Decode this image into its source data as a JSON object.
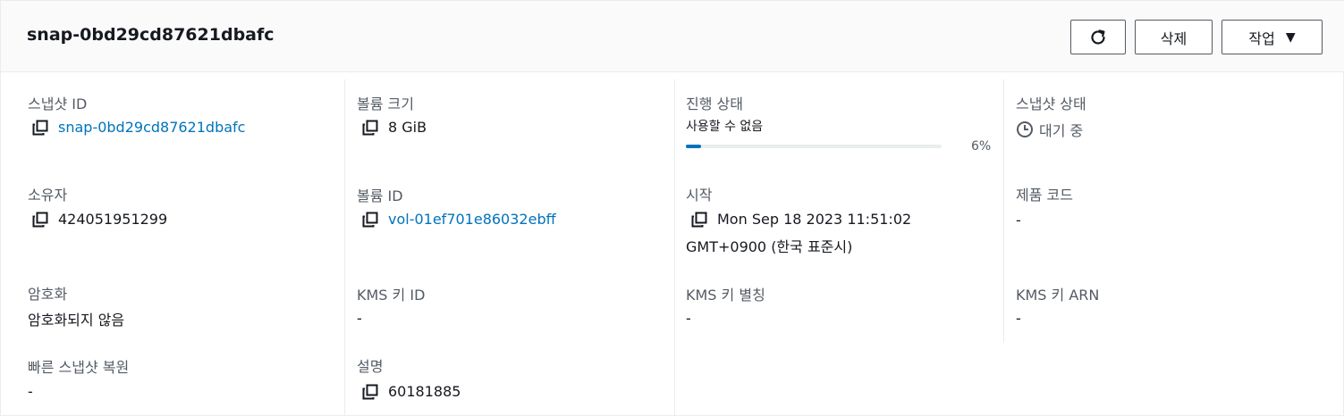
{
  "header": {
    "title": "snap-0bd29cd87621dbafc",
    "refresh_icon": "refresh-icon",
    "delete_label": "삭제",
    "actions_label": "작업",
    "actions_caret": "▼"
  },
  "details": {
    "snapshot_id": {
      "label": "스냅샷 ID",
      "value": "snap-0bd29cd87621dbafc"
    },
    "volume_size": {
      "label": "볼륨 크기",
      "value": "8 GiB"
    },
    "progress": {
      "label": "진행 상태",
      "sub": "사용할 수 없음",
      "percent_text": "6%",
      "percent": 6
    },
    "snapshot_state": {
      "label": "스냅샷 상태",
      "value": "대기 중"
    },
    "owner": {
      "label": "소유자",
      "value": "424051951299"
    },
    "volume_id": {
      "label": "볼륨 ID",
      "value": "vol-01ef701e86032ebff"
    },
    "started": {
      "label": "시작",
      "value_line1": "Mon Sep 18 2023 11:51:02",
      "value_line2": "GMT+0900 (한국 표준시)"
    },
    "product_codes": {
      "label": "제품 코드",
      "value": "-"
    },
    "encryption": {
      "label": "암호화",
      "value": "암호화되지 않음"
    },
    "kms_key_id": {
      "label": "KMS 키 ID",
      "value": "-"
    },
    "kms_key_alias": {
      "label": "KMS 키 별칭",
      "value": "-"
    },
    "kms_key_arn": {
      "label": "KMS 키 ARN",
      "value": "-"
    },
    "fast_snapshot_restore": {
      "label": "빠른 스냅샷 복원",
      "value": "-"
    },
    "description": {
      "label": "설명",
      "value": "60181885"
    }
  },
  "colors": {
    "link": "#0073bb",
    "progress": "#0073bb",
    "border": "#eaeded"
  }
}
